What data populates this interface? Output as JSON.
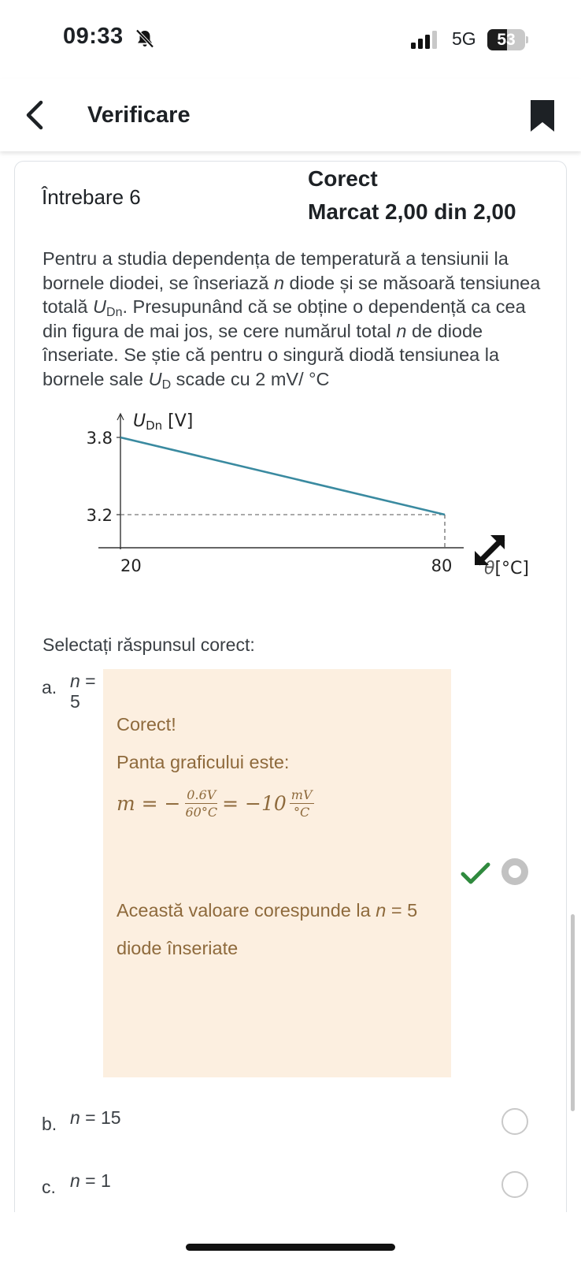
{
  "status_bar": {
    "time": "09:33",
    "network": "5G",
    "battery": "53",
    "battery_level_percent": 53
  },
  "header": {
    "title": "Verificare"
  },
  "question": {
    "number_label": "Întrebare 6",
    "state": "Corect",
    "grade": "Marcat 2,00 din 2,00",
    "text_part1": "Pentru a studia dependența de temperatură a tensiunii la bornele diodei, se înseriază ",
    "text_n1": "n",
    "text_part2": " diode și se măsoară tensiunea totală ",
    "text_u1": "U",
    "text_u1_sub": "Dn",
    "text_part3": ". Presupunând că se obține o dependență ca cea din figura de mai jos, se cere numărul total ",
    "text_n2": "n",
    "text_part4": " de diode înseriate. Se știe că pentru o singură diodă tensiunea la bornele sale ",
    "text_u2": "U",
    "text_u2_sub": "D",
    "text_part5": " scade cu 2 mV/ °C",
    "prompt": "Selectați răspunsul corect:"
  },
  "chart_data": {
    "type": "line",
    "ylabel_main": "U",
    "ylabel_sub": "Dn",
    "ylabel_unit": "[V]",
    "xlabel_symbol": "θ",
    "xlabel_unit": "[°C]",
    "x": [
      20,
      80
    ],
    "y": [
      3.8,
      3.2
    ],
    "x_ticks": [
      "20",
      "80"
    ],
    "y_ticks": [
      "3.8",
      "3.2"
    ],
    "line_color": "#3a8aa0"
  },
  "options": [
    {
      "letter": "a.",
      "text": "n =\n5",
      "var": "n",
      "value": "5",
      "selected": true,
      "correct": true
    },
    {
      "letter": "b.",
      "var": "n",
      "value": "15",
      "selected": false
    },
    {
      "letter": "c.",
      "var": "n",
      "value": "1",
      "selected": false
    }
  ],
  "feedback": {
    "line1": "Corect!",
    "line2": "Panta graficului este:",
    "formula_lhs": "m = −",
    "formula_num": "0.6V",
    "formula_den": "60°C",
    "formula_mid": "= −10",
    "formula_unit_num": "mV",
    "formula_unit_den": "°C",
    "line3_a": "Această valoare corespunde la ",
    "line3_var": "n",
    "line3_b": " = 5",
    "line4": "diode înseriate"
  },
  "colors": {
    "feedback_bg": "#fcefe0",
    "feedback_text": "#8e6a3c",
    "check_green": "#2f8a3e",
    "chart_line": "#3a8aa0"
  }
}
